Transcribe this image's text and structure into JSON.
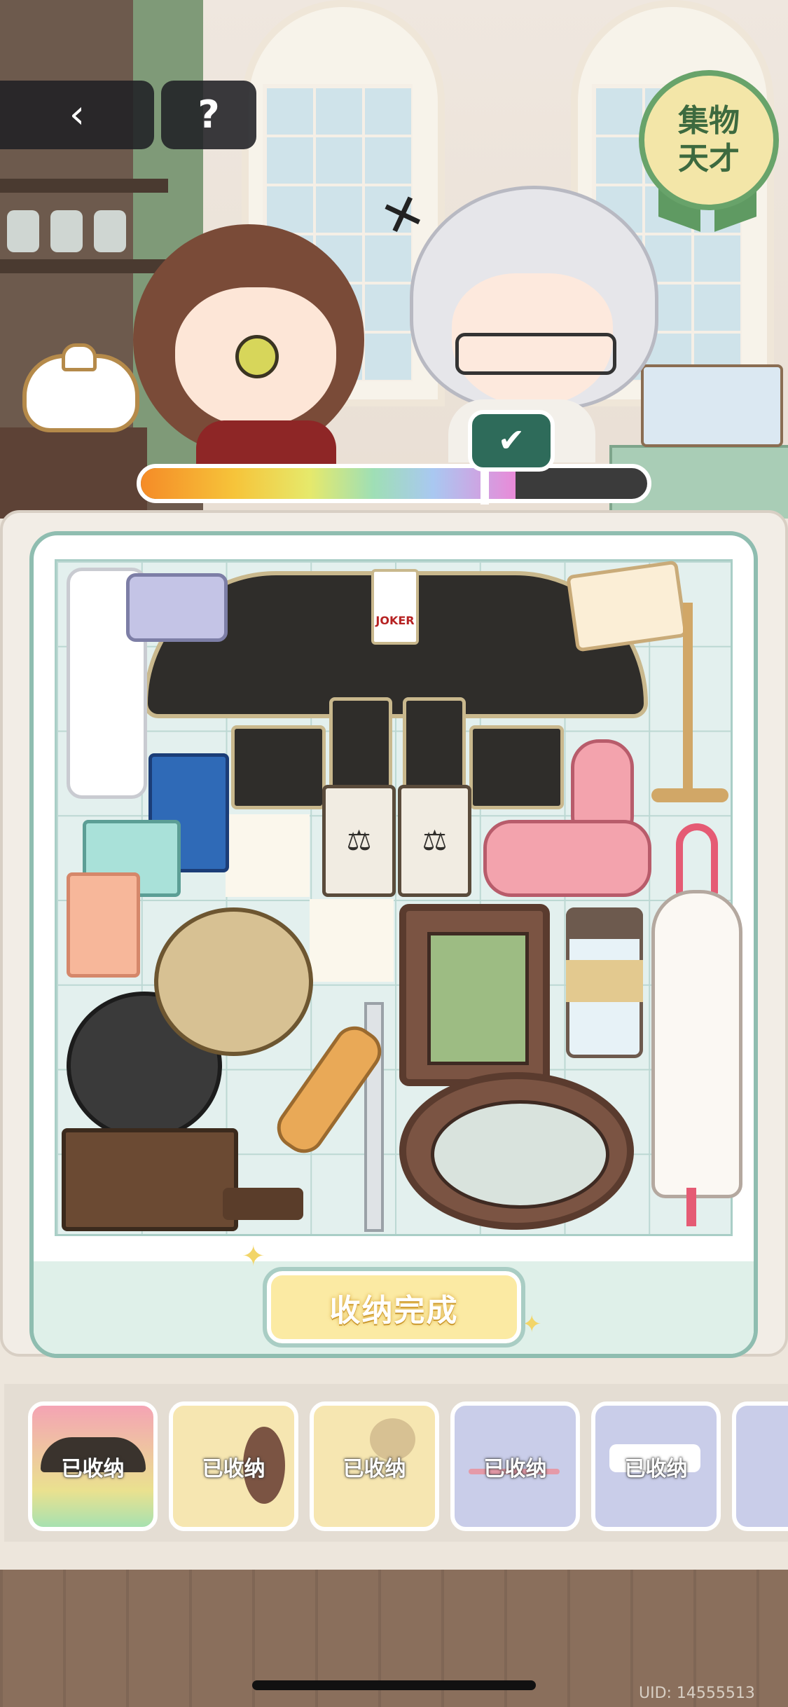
{
  "toolbar": {
    "back_glyph": "‹",
    "help_label": "?"
  },
  "badge": {
    "title": "集物天才"
  },
  "progress": {
    "fraction": 0.74,
    "check_glyph": "✔"
  },
  "board": {
    "joker_label": "JOKER",
    "scale_glyph": "⚖",
    "complete_button": "收纳完成",
    "sparkle_glyph": "✦"
  },
  "inventory": {
    "items": [
      {
        "label": "已收纳",
        "icon": "card-fan-icon",
        "color": "#f3b7c0"
      },
      {
        "label": "已收纳",
        "icon": "mirror-icon",
        "color": "#f6e6b1"
      },
      {
        "label": "已收纳",
        "icon": "gramophone-icon",
        "color": "#f6e6b1"
      },
      {
        "label": "已收纳",
        "icon": "umbrella-icon",
        "color": "#c9cde9"
      },
      {
        "label": "已收纳",
        "icon": "hairdryer-icon",
        "color": "#c9cde9"
      }
    ]
  },
  "footer": {
    "uid": "UID: 14555513"
  }
}
